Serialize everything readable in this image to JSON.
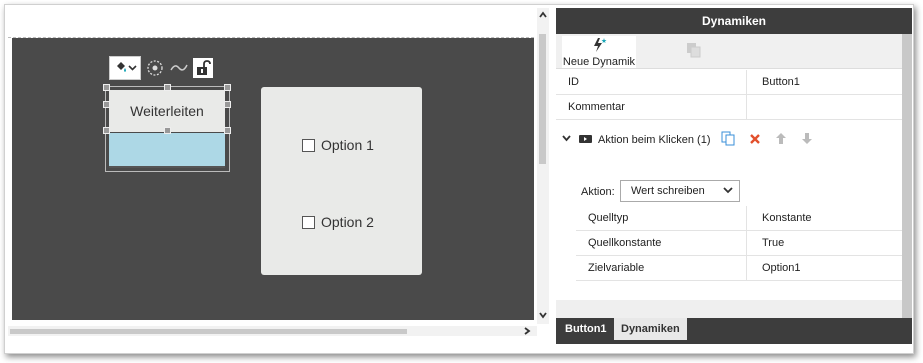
{
  "canvas": {
    "button_label": "Weiterleiten",
    "checkbox_options": [
      "Option 1",
      "Option 2"
    ]
  },
  "panel": {
    "title": "Dynamiken",
    "new_dynamic_label": "Neue Dynamik",
    "props": [
      {
        "key": "ID",
        "value": "Button1"
      },
      {
        "key": "Kommentar",
        "value": ""
      }
    ],
    "action_header": "Aktion beim Klicken (1)",
    "action_label": "Aktion:",
    "action_select": "Wert schreiben",
    "sub_props": [
      {
        "key": "Quelltyp",
        "value": "Konstante"
      },
      {
        "key": "Quellkonstante",
        "value": "True"
      },
      {
        "key": "Zielvariable",
        "value": "Option1"
      }
    ],
    "tabs": [
      "Button1",
      "Dynamiken"
    ]
  },
  "colors": {
    "canvas_bg": "#4a4a4a",
    "panel_header": "#3d3d3d",
    "button_fill": "#add8e6",
    "delete_red": "#e2502c",
    "copy_blue": "#3a8fd8",
    "new_dynamic_teal": "#1aa6b7"
  },
  "icons": [
    "fill-icon",
    "chevron-down-icon",
    "target-icon",
    "wave-icon",
    "unlock-icon",
    "lightning-star-icon",
    "copy-icon",
    "close-icon",
    "arrow-up-icon",
    "arrow-down-icon",
    "expand-chevron-icon",
    "action-icon"
  ]
}
